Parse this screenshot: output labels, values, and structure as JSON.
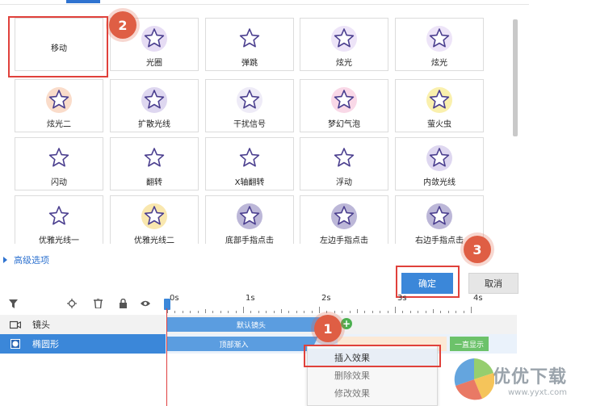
{
  "effects": [
    {
      "label": "移动",
      "icon": "star-plain-icon",
      "selected": true
    },
    {
      "label": "光圈",
      "icon": "star-halo-icon"
    },
    {
      "label": "弹跳",
      "icon": "star-bounce-icon"
    },
    {
      "label": "炫光",
      "icon": "star-flare-icon"
    },
    {
      "label": "炫光",
      "icon": "star-flare-icon"
    },
    {
      "label": "炫光二",
      "icon": "star-flare-orange-icon"
    },
    {
      "label": "扩散光线",
      "icon": "star-rays-icon"
    },
    {
      "label": "干扰信号",
      "icon": "star-noise-icon"
    },
    {
      "label": "梦幻气泡",
      "icon": "star-bubbles-icon"
    },
    {
      "label": "萤火虫",
      "icon": "star-firefly-icon"
    },
    {
      "label": "闪动",
      "icon": "star-flash-icon"
    },
    {
      "label": "翻转",
      "icon": "star-flip-icon"
    },
    {
      "label": "X轴翻转",
      "icon": "star-flip-x-icon"
    },
    {
      "label": "浮动",
      "icon": "star-float-icon"
    },
    {
      "label": "内敛光线",
      "icon": "star-inner-rays-icon"
    },
    {
      "label": "优雅光线一",
      "icon": "star-elegant-icon"
    },
    {
      "label": "优雅光线二",
      "icon": "star-elegant-color-icon"
    },
    {
      "label": "底部手指点击",
      "icon": "star-finger-bottom-icon"
    },
    {
      "label": "左边手指点击",
      "icon": "star-finger-left-icon"
    },
    {
      "label": "右边手指点击",
      "icon": "star-finger-right-icon"
    }
  ],
  "callouts": {
    "one": "1",
    "two": "2",
    "three": "3"
  },
  "advanced": "高级选项",
  "buttons": {
    "ok": "确定",
    "cancel": "取消"
  },
  "ruler": [
    "0s",
    "1s",
    "2s",
    "3s",
    "4s"
  ],
  "tracks": [
    {
      "name": "镜头",
      "icon": "camera-icon"
    },
    {
      "name": "椭圆形",
      "icon": "ellipse-icon"
    }
  ],
  "bars": {
    "camera_default": "默认镜头",
    "enter_top": "顶部渐入",
    "always_show": "一直显示"
  },
  "context_menu": [
    "插入效果",
    "删除效果",
    "修改效果"
  ],
  "watermark": {
    "main": "优优下载",
    "sub": "www.yyxt.com"
  },
  "colors": {
    "accent": "#3b87d9",
    "callout": "#e0413b",
    "badge": "#df5e44",
    "green": "#6cc26a"
  }
}
